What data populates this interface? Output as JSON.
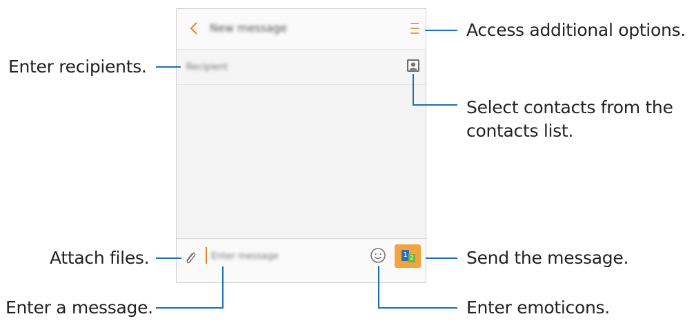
{
  "screen": {
    "title": "New message",
    "recipient_placeholder": "Recipient",
    "message_placeholder": "Enter message",
    "send_sim_primary": "1",
    "send_sim_secondary": "2",
    "accent_color": "#e8852a",
    "send_button_color": "#f3a43e"
  },
  "callouts": {
    "options": "Access additional options.",
    "recipients": "Enter recipients.",
    "contacts_line1": "Select contacts from the",
    "contacts_line2": "contacts list.",
    "attach": "Attach files.",
    "send": "Send the message.",
    "message": "Enter a message.",
    "emoticons": "Enter emoticons."
  },
  "icons": {
    "back": "chevron-left-icon",
    "menu": "menu-icon",
    "contact": "contact-icon",
    "attach": "paperclip-icon",
    "emoticon": "smiley-icon",
    "send": "sim-send-icon"
  }
}
